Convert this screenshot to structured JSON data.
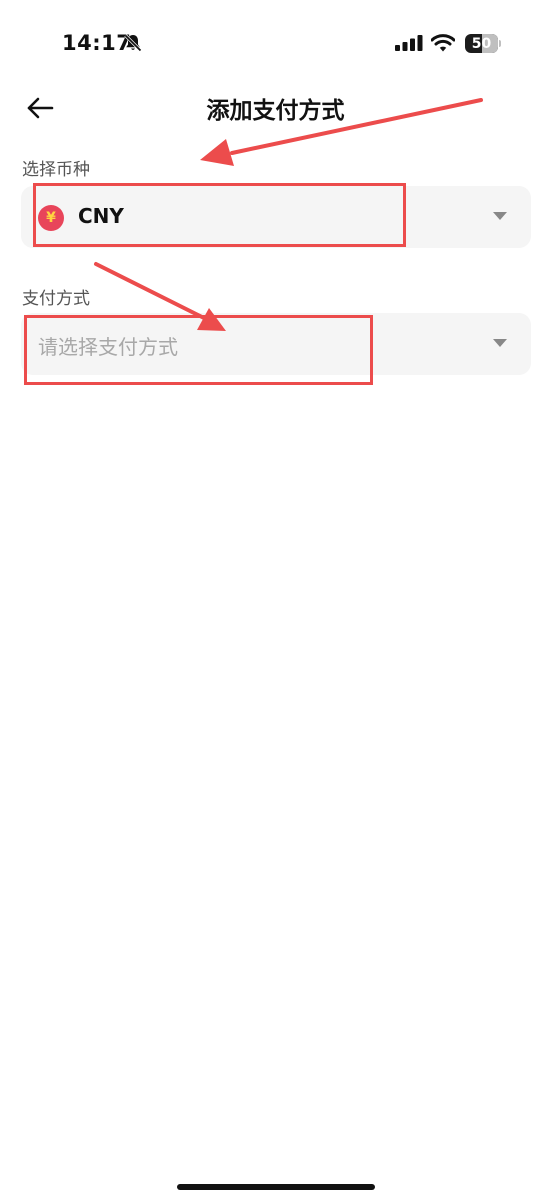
{
  "status_bar": {
    "time": "14:17",
    "battery_level": "50",
    "battery_fraction": 0.5,
    "icons": [
      "bell-slash-icon",
      "cellular-signal-icon",
      "wifi-icon",
      "battery-icon"
    ]
  },
  "header": {
    "title": "添加支付方式",
    "back_icon": "arrow-left-icon"
  },
  "currency": {
    "label": "选择币种",
    "value": "CNY",
    "symbol": "¥",
    "icon": "yuan-coin-icon",
    "icon_color": "#e8455a",
    "symbol_color": "#ffd640"
  },
  "payment_method": {
    "label": "支付方式",
    "placeholder": "请选择支付方式"
  },
  "annotation_color": "#ec4c4c"
}
